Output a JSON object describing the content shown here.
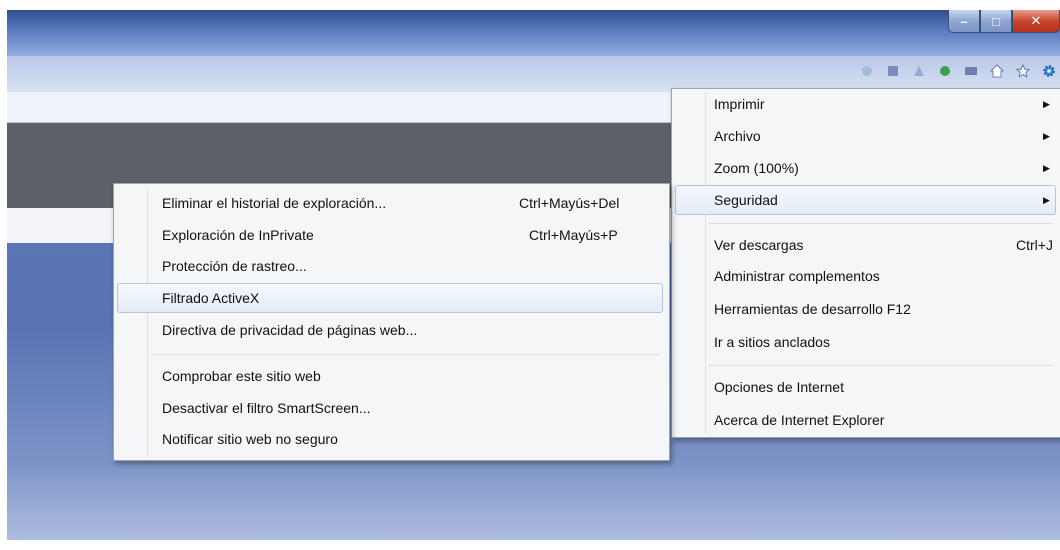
{
  "window": {
    "controls": {
      "minimize": "–",
      "maximize": "□",
      "close": "✕"
    },
    "toolbar_icons": [
      "home-icon",
      "favorites-star-icon",
      "tools-gear-icon"
    ]
  },
  "tools_menu": {
    "items": [
      {
        "label": "Imprimir",
        "has_submenu": true
      },
      {
        "label": "Archivo",
        "has_submenu": true
      },
      {
        "label": "Zoom (100%)",
        "has_submenu": true
      },
      {
        "label": "Seguridad",
        "has_submenu": true,
        "highlighted": true
      },
      {
        "label": "Ver descargas",
        "shortcut": "Ctrl+J"
      },
      {
        "label": "Administrar complementos"
      },
      {
        "label": "Herramientas de desarrollo F12"
      },
      {
        "label": "Ir a sitios anclados"
      },
      {
        "label": "Opciones de Internet"
      },
      {
        "label": "Acerca de Internet Explorer"
      }
    ],
    "arrow_glyph": "▶"
  },
  "security_submenu": {
    "items": [
      {
        "label": "Eliminar el historial de exploración...",
        "shortcut": "Ctrl+Mayús+Del"
      },
      {
        "label": "Exploración de InPrivate",
        "shortcut": "Ctrl+Mayús+P"
      },
      {
        "label": "Protección de rastreo..."
      },
      {
        "label": "Filtrado ActiveX",
        "highlighted": true
      },
      {
        "label": "Directiva de privacidad de páginas web..."
      },
      {
        "label": "Comprobar este sitio web"
      },
      {
        "label": "Desactivar el filtro SmartScreen..."
      },
      {
        "label": "Notificar sitio web no seguro"
      }
    ]
  },
  "colors": {
    "highlight_border": "#aec6e6",
    "menu_background": "#f5f6f8",
    "close_button": "#c8452c"
  }
}
